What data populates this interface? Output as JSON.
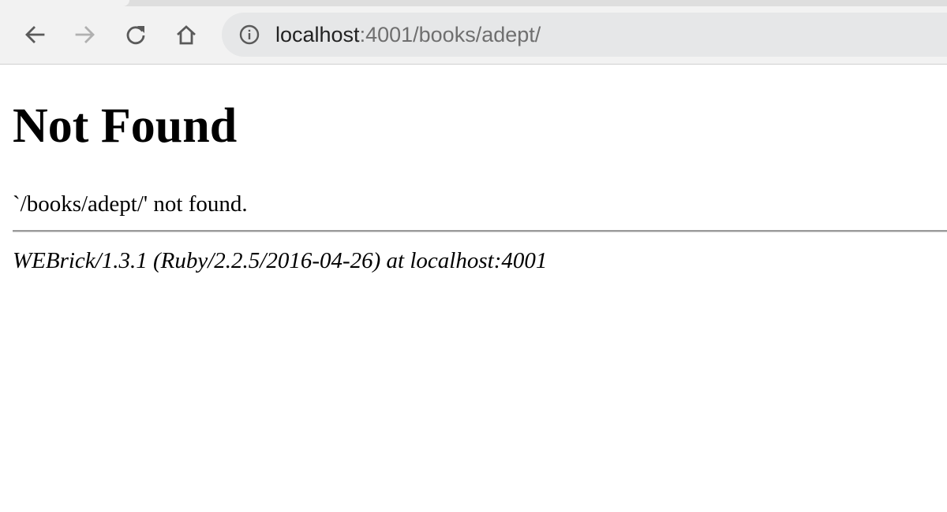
{
  "browser": {
    "nav": {
      "back_icon": "arrow-left-icon",
      "forward_icon": "arrow-right-icon",
      "reload_icon": "reload-icon",
      "home_icon": "home-icon"
    },
    "omnibox": {
      "site_info_icon": "info-circle-icon",
      "url_host": "localhost",
      "url_rest": ":4001/books/adept/"
    }
  },
  "page": {
    "title": "Not Found",
    "message": "`/books/adept/' not found.",
    "server_signature": "WEBrick/1.3.1 (Ruby/2.2.5/2016-04-26) at localhost:4001"
  },
  "colors": {
    "toolbar_bg": "#f2f2f2",
    "omnibox_bg": "#e6e7e8",
    "icon_active": "#5a5a5a",
    "icon_disabled": "#b0b0b0",
    "url_host": "#222222",
    "url_rest": "#6f6f6f"
  }
}
